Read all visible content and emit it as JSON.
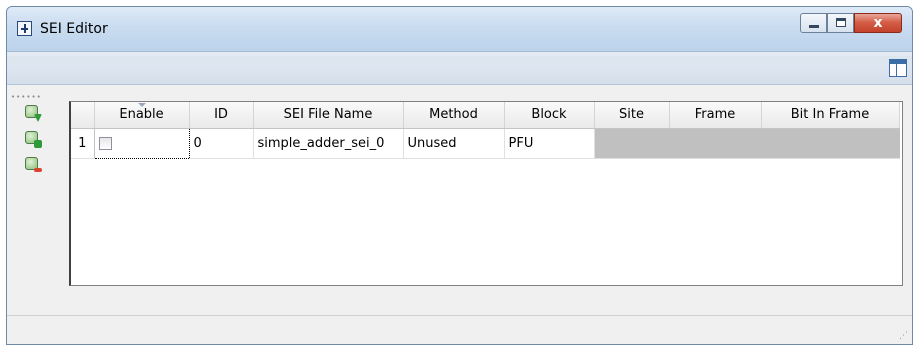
{
  "window": {
    "title": "SEI Editor",
    "close_glyph": "x"
  },
  "side_toolbar": {
    "buttons": [
      {
        "icon": "download-chip-icon"
      },
      {
        "icon": "add-chip-icon"
      },
      {
        "icon": "remove-chip-icon"
      }
    ]
  },
  "table": {
    "columns": [
      "Enable",
      "ID",
      "SEI File Name",
      "Method",
      "Block",
      "Site",
      "Frame",
      "Bit In Frame"
    ],
    "rows": [
      {
        "row_number": "1",
        "enable": false,
        "id": "0",
        "sei_file_name": "simple_adder_sei_0",
        "method": "Unused",
        "block": "PFU",
        "site": "",
        "frame": "",
        "bit_in_frame": ""
      }
    ]
  },
  "colors": {
    "titlebar": "#c9dcf0",
    "close_button": "#c3412a",
    "disabled_cell": "#c0c0c0"
  }
}
